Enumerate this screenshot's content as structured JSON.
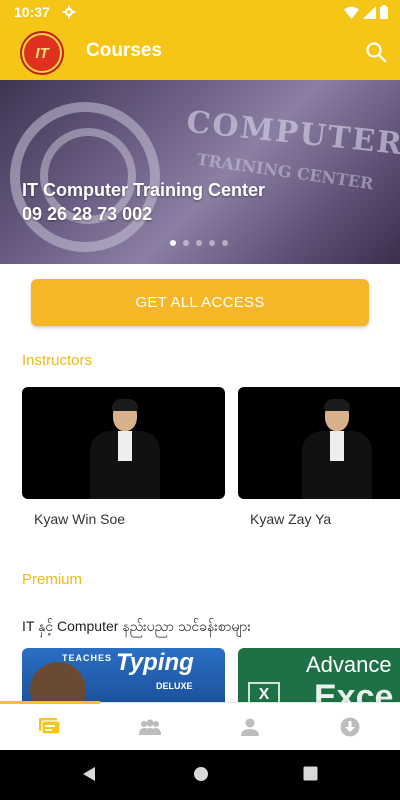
{
  "status_bar": {
    "time": "10:37"
  },
  "app_bar": {
    "logo_text": "IT",
    "title": "Courses"
  },
  "banner": {
    "background_lettering": "COMPUTER",
    "background_sub_lettering": "TRAINING CENTER",
    "line1": "IT Computer Training Center",
    "line2": "09 26 28 73 002",
    "slide_count": 5,
    "active_slide": 1
  },
  "cta": {
    "label": "GET ALL ACCESS"
  },
  "sections": {
    "instructors": "Instructors",
    "premium": "Premium"
  },
  "instructors": [
    {
      "name": "Kyaw Win Soe"
    },
    {
      "name": "Kyaw Zay Ya"
    }
  ],
  "premium": {
    "heading": "IT နှင့် Computer နည်းပညာ သင်ခန်းစာများ",
    "courses": [
      {
        "thumb_small": "TEACHES",
        "thumb_title": "Typing",
        "thumb_sub": "DELUXE"
      },
      {
        "thumb_title": "Advance",
        "thumb_word": "Exce"
      }
    ]
  },
  "bottom_nav": {
    "items": [
      {
        "icon": "courses-icon",
        "active": true
      },
      {
        "icon": "people-icon",
        "active": false
      },
      {
        "icon": "profile-icon",
        "active": false
      },
      {
        "icon": "download-icon",
        "active": false
      }
    ]
  },
  "colors": {
    "primary": "#f5c518",
    "cta": "#f5b728",
    "section_title": "#f2b90f",
    "nav_inactive": "#bdbdbd"
  }
}
